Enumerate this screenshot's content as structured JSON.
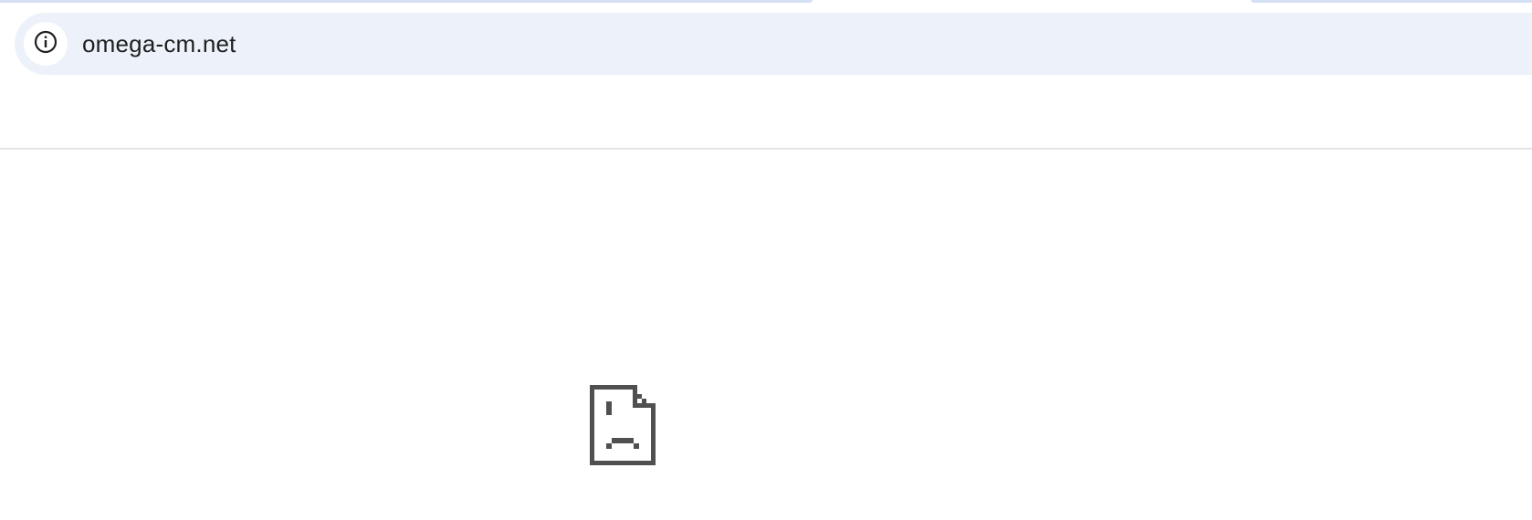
{
  "browser": {
    "address_bar": {
      "url": "omega-cm.net",
      "site_info_icon": "info-icon"
    }
  },
  "error_page": {
    "icon": "sad-page-icon"
  },
  "colors": {
    "omnibox_background": "#ecf1fa",
    "tab_accent": "#d6e0f5",
    "icon_gray": "#505050",
    "text": "#1f1f1f"
  }
}
